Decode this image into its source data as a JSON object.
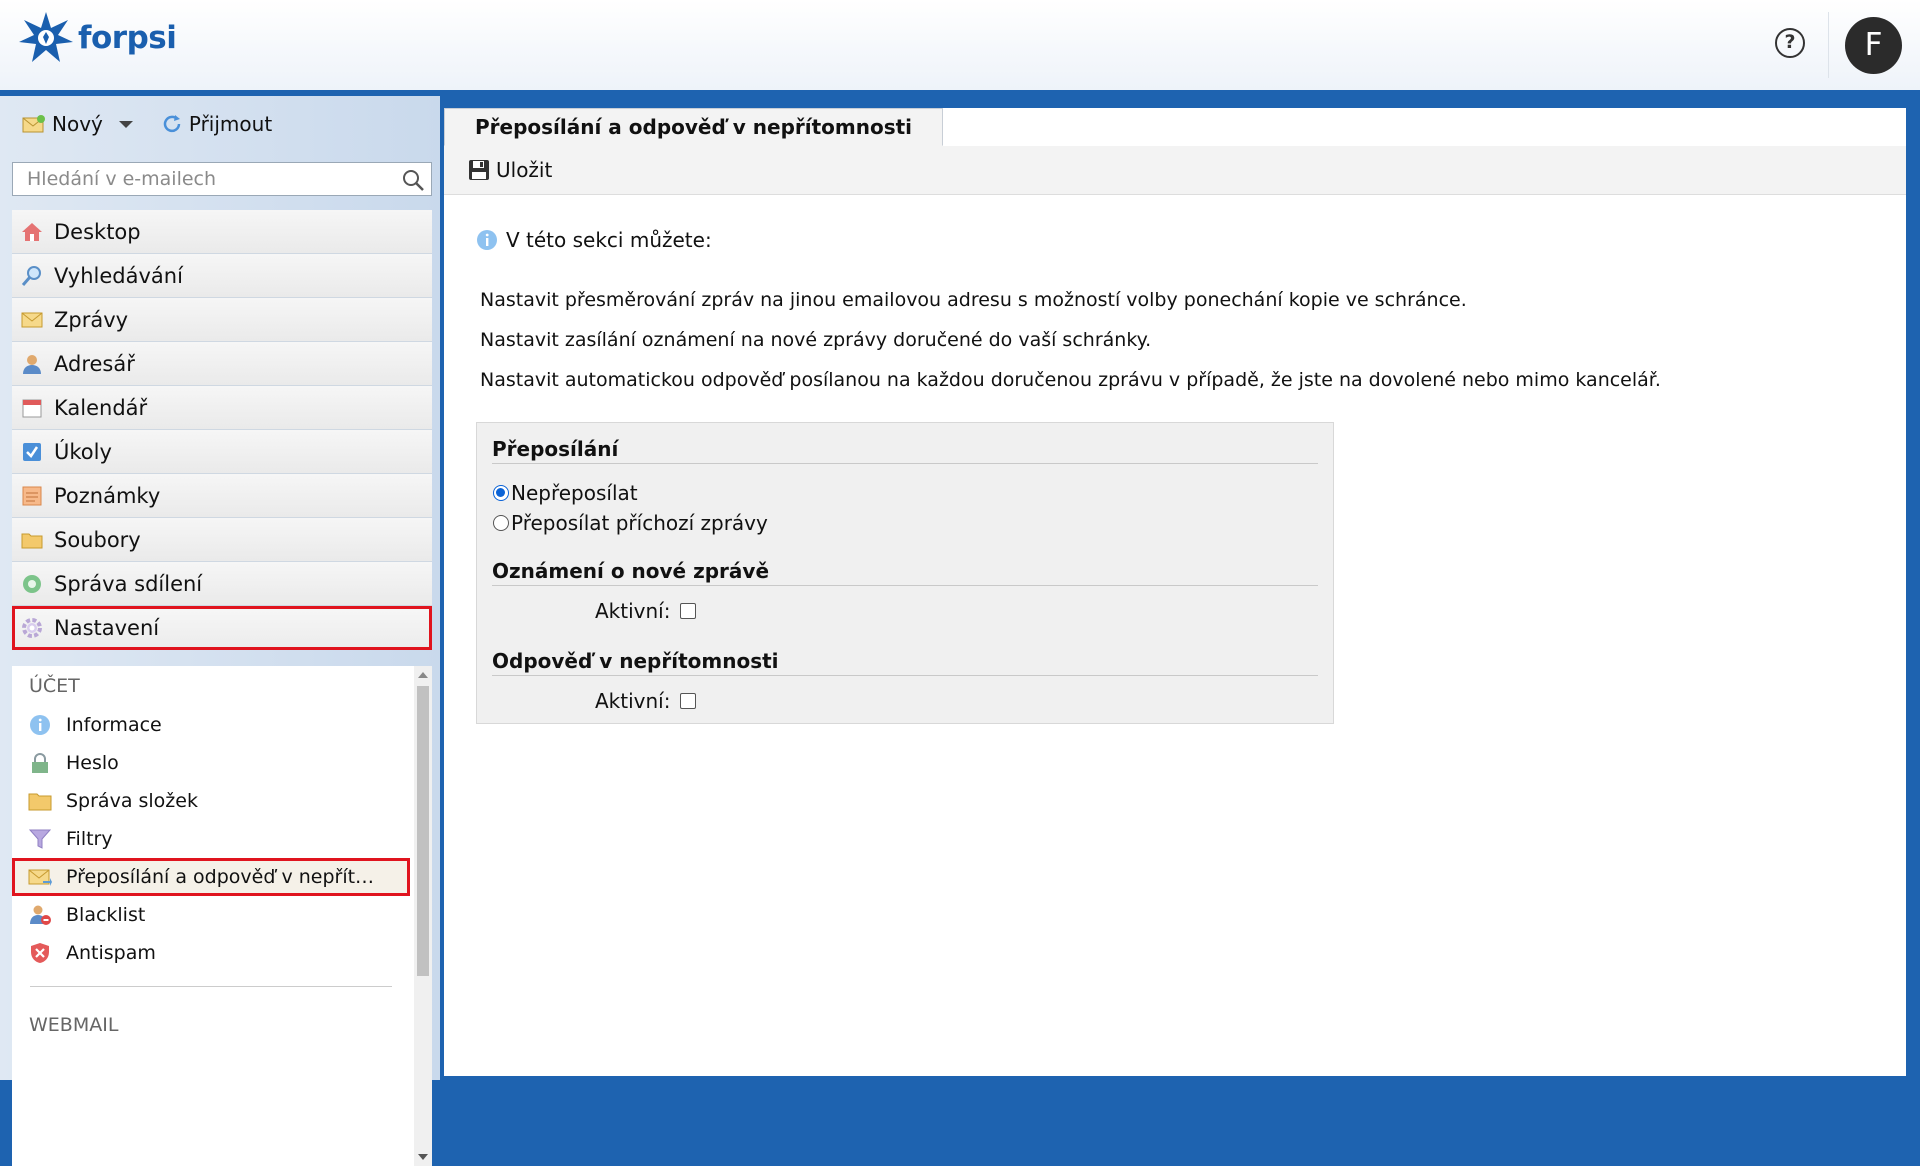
{
  "brand": {
    "name": "forpsi"
  },
  "header": {
    "help_glyph": "?",
    "avatar_letter": "F"
  },
  "toolbar": {
    "new_label": "Nový",
    "receive_label": "Přijmout"
  },
  "search": {
    "placeholder": "Hledání v e-mailech"
  },
  "nav": {
    "items": [
      {
        "label": "Desktop",
        "icon": "home-icon"
      },
      {
        "label": "Vyhledávání",
        "icon": "magnifier-icon"
      },
      {
        "label": "Zprávy",
        "icon": "envelope-icon"
      },
      {
        "label": "Adresář",
        "icon": "contacts-icon"
      },
      {
        "label": "Kalendář",
        "icon": "calendar-icon"
      },
      {
        "label": "Úkoly",
        "icon": "checkbox-icon"
      },
      {
        "label": "Poznámky",
        "icon": "notes-icon"
      },
      {
        "label": "Soubory",
        "icon": "folder-icon"
      },
      {
        "label": "Správa sdílení",
        "icon": "sharing-icon"
      },
      {
        "label": "Nastavení",
        "icon": "gear-icon",
        "active": true
      }
    ]
  },
  "settings_menu": {
    "account_heading": "ÚČET",
    "items": [
      {
        "label": "Informace",
        "icon": "info-icon"
      },
      {
        "label": "Heslo",
        "icon": "lock-icon"
      },
      {
        "label": "Správa složek",
        "icon": "folder-icon"
      },
      {
        "label": "Filtry",
        "icon": "filter-icon"
      },
      {
        "label": "Přeposílání a odpověď v nepřít…",
        "icon": "forward-envelope-icon",
        "active": true
      },
      {
        "label": "Blacklist",
        "icon": "blacklist-icon"
      },
      {
        "label": "Antispam",
        "icon": "shield-icon"
      }
    ],
    "webmail_heading": "WEBMAIL"
  },
  "content": {
    "tab_title": "Přeposílání a odpověď v nepřítomnosti",
    "save_label": "Uložit",
    "info_text": "V této sekci můžete:",
    "lines": [
      "Nastavit přesměrování zpráv na jinou emailovou adresu s možností volby ponechání kopie ve schránce.",
      "Nastavit zasílání oznámení na nové zprávy doručené do vaší schránky.",
      "Nastavit automatickou odpověď posílanou na každou doručenou zprávu v případě, že jste na dovolené nebo mimo kancelář."
    ],
    "forwarding": {
      "title": "Přeposílání",
      "option_none": "Nepřeposílat",
      "option_forward": "Přeposílat příchozí zprávy",
      "selected": "Nepřeposílat"
    },
    "notification": {
      "title": "Oznámení o nové zprávě",
      "active_label": "Aktivní:",
      "checked": false
    },
    "autoreply": {
      "title": "Odpověď v nepřítomnosti",
      "active_label": "Aktivní:",
      "checked": false
    }
  },
  "colors": {
    "brand_blue": "#1e63b0",
    "highlight_red": "#e0141e",
    "radio_blue": "#0b63d6"
  }
}
